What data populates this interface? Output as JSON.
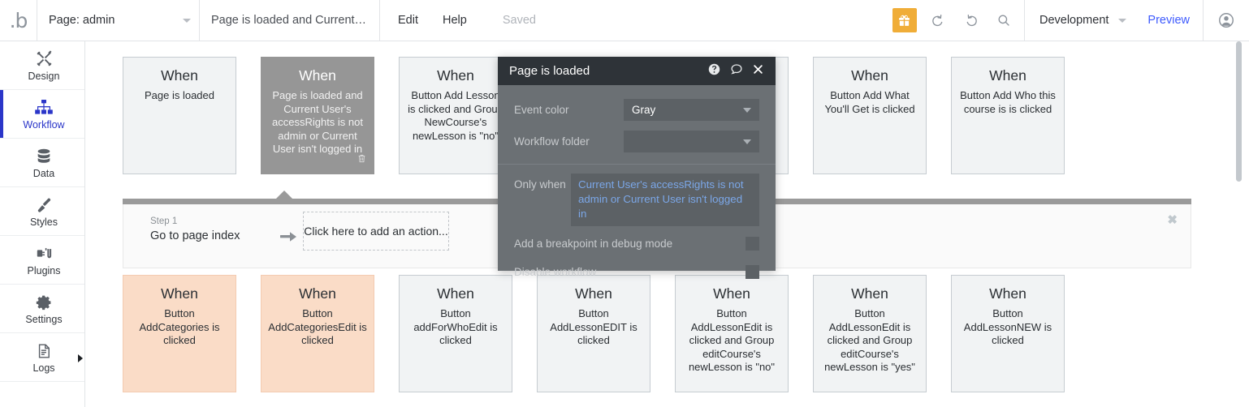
{
  "topbar": {
    "logo": "b",
    "page_select": {
      "label": "Page: admin",
      "caret_icon": "chevron-down-icon"
    },
    "workflow_name": "Page is loaded and Current User's a...",
    "menu": [
      "Edit",
      "Help"
    ],
    "save_status": "Saved",
    "gift_icon": "gift-icon",
    "undo_icon": "undo-icon",
    "redo_icon": "redo-icon",
    "search_icon": "search-icon",
    "version": "Development",
    "preview": "Preview",
    "avatar_icon": "user-avatar-icon",
    "accent_gift_color": "#f0ad38",
    "preview_link_color": "#3d5afe"
  },
  "sidebar": {
    "active_color": "#2b36c9",
    "items": [
      {
        "label": "Design",
        "icon": "design-tools-icon",
        "active": false
      },
      {
        "label": "Workflow",
        "icon": "workflow-tree-icon",
        "active": true
      },
      {
        "label": "Data",
        "icon": "database-icon",
        "active": false
      },
      {
        "label": "Styles",
        "icon": "paintbrush-icon",
        "active": false
      },
      {
        "label": "Plugins",
        "icon": "plug-icon",
        "active": false
      },
      {
        "label": "Settings",
        "icon": "gear-icon",
        "active": false
      },
      {
        "label": "Logs",
        "icon": "document-icon",
        "active": false
      }
    ],
    "expand_icon": "expand-panel-arrow-icon"
  },
  "canvas": {
    "row1": [
      {
        "when": "When",
        "condition": "Page is loaded",
        "color": "gray",
        "selected": false
      },
      {
        "when": "When",
        "condition": "Page is loaded and Current User's accessRights is not admin or Current User isn't logged in",
        "color": "gray",
        "selected": true,
        "trash_icon": "trash-icon"
      },
      {
        "when": "When",
        "condition": "Button Add Lesson is clicked and Group NewCourse's newLesson is \"no\"",
        "color": "gray",
        "selected": false
      },
      {
        "when": "When",
        "condition": "",
        "color": "gray",
        "selected": false
      },
      {
        "when": "When",
        "condition": "",
        "color": "gray",
        "selected": false
      },
      {
        "when": "When",
        "condition": "Button Add What You'll Get is clicked",
        "color": "gray",
        "selected": false
      },
      {
        "when": "When",
        "condition": "Button Add Who this course is is clicked",
        "color": "gray",
        "selected": false
      }
    ],
    "row2": [
      {
        "when": "When",
        "condition": "Button AddCategories is clicked",
        "color": "orange",
        "selected": false
      },
      {
        "when": "When",
        "condition": "Button AddCategoriesEdit is clicked",
        "color": "orange",
        "selected": false
      },
      {
        "when": "When",
        "condition": "Button addForWhoEdit is clicked",
        "color": "gray",
        "selected": false
      },
      {
        "when": "When",
        "condition": "Button AddLessonEDIT is clicked",
        "color": "gray",
        "selected": false
      },
      {
        "when": "When",
        "condition": "Button AddLessonEdit is clicked and Group editCourse's newLesson is \"no\"",
        "color": "gray",
        "selected": false
      },
      {
        "when": "When",
        "condition": "Button AddLessonEdit is clicked and Group editCourse's newLesson is \"yes\"",
        "color": "gray",
        "selected": false
      },
      {
        "when": "When",
        "condition": "Button AddLessonNEW is clicked",
        "color": "gray",
        "selected": false
      }
    ],
    "step_panel": {
      "step_number": "Step 1",
      "step_title": "Go to page index",
      "arrow_icon": "arrow-right-icon",
      "add_action_placeholder": "Click here to add an action...",
      "close_icon": "close-icon"
    },
    "scrollbar_icon": "vertical-scrollbar"
  },
  "modal": {
    "title": "Page is loaded",
    "help_icon": "help-circle-icon",
    "comment_icon": "comment-bubble-icon",
    "close_icon": "close-icon",
    "event_color": {
      "label": "Event color",
      "value": "Gray",
      "caret_icon": "chevron-down-icon"
    },
    "workflow_folder": {
      "label": "Workflow folder",
      "value": "",
      "caret_icon": "chevron-down-icon"
    },
    "only_when": {
      "label": "Only when",
      "value": "Current User's accessRights is not admin or Current User isn't logged in",
      "value_color": "#7ba7e8"
    },
    "breakpoint": {
      "label": "Add a breakpoint in debug mode",
      "checked": false
    },
    "disable": {
      "label": "Disable workflow",
      "checked": false
    }
  }
}
